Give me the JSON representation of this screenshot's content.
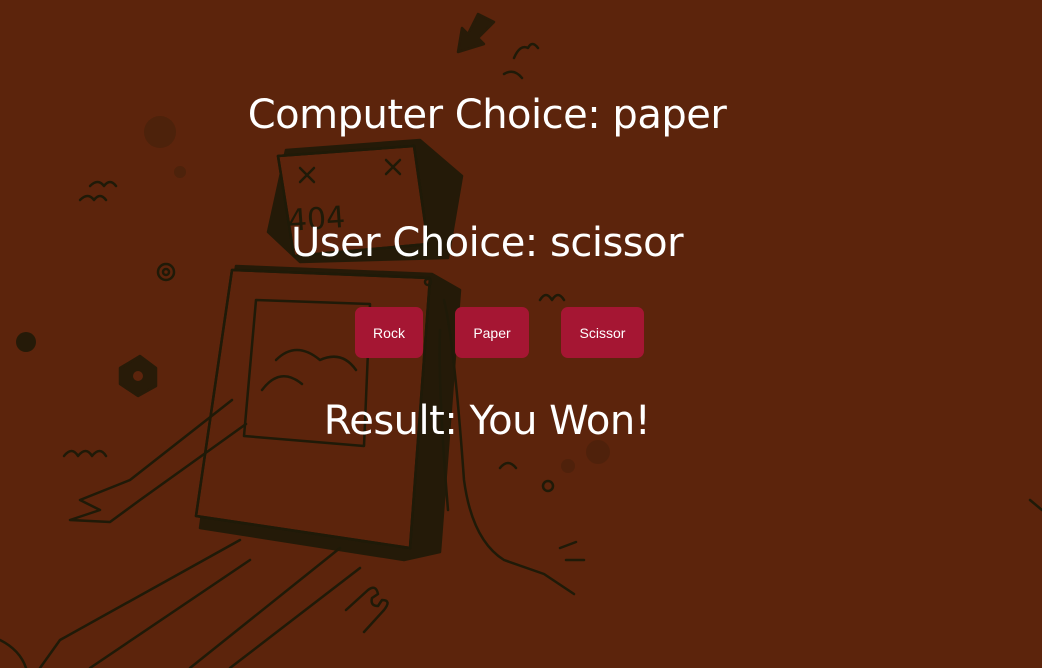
{
  "game": {
    "computer_choice_label": "Computer Choice: paper",
    "user_choice_label": "User Choice: scissor",
    "result_label": "Result: You Won!"
  },
  "buttons": {
    "rock_label": "Rock",
    "paper_label": "Paper",
    "scissor_label": "Scissor"
  },
  "colors": {
    "background": "#5c240c",
    "button": "#a51633",
    "text": "#ffffff",
    "illustration_ink": "#1f1a08"
  },
  "background_illustration": {
    "screen_text": "404"
  }
}
